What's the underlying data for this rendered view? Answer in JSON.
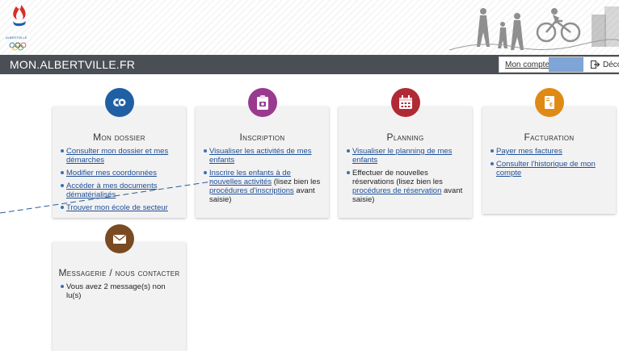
{
  "header": {
    "logo_icon": "albertville-olympic-flame-logo",
    "scene_icon": "family-walking-bicycle-scene"
  },
  "topbar": {
    "site_name": "MON.ALBERTVILLE.FR",
    "account_label": "Mon compte",
    "logout_label": "Déco"
  },
  "cards": {
    "dossier": {
      "icon": "users-icon",
      "color": "#1f5fa3",
      "title": "Mon dossier",
      "items": [
        {
          "link": "Consulter mon dossier et mes démarches"
        },
        {
          "link": "Modifier mes coordonnées"
        },
        {
          "link": "Accéder à mes documents dématérialisés"
        },
        {
          "link": "Trouver mon école de secteur"
        }
      ]
    },
    "inscription": {
      "icon": "clipboard-camera-icon",
      "color": "#9a3a8e",
      "title": "Inscription",
      "items": [
        {
          "link": "Visualiser les activités de mes enfants"
        },
        {
          "link": "Inscrire les enfants à de nouvelles activités",
          "text": " (lisez bien les ",
          "link2": "procédures d'inscriptions",
          "text2": " avant saisie)"
        }
      ]
    },
    "planning": {
      "icon": "calendar-icon",
      "color": "#b02a35",
      "title": "Planning",
      "items": [
        {
          "link": "Visualiser le planning de mes enfants"
        },
        {
          "text": "Effectuer de nouvelles réservations (lisez bien les ",
          "link2": "procédures de réservation",
          "text2": " avant saisie)"
        }
      ]
    },
    "facturation": {
      "icon": "invoice-euro-icon",
      "color": "#e08a16",
      "title": "Facturation",
      "items": [
        {
          "link": "Payer mes factures"
        },
        {
          "link": "Consulter l'historique de mon compte"
        }
      ]
    },
    "messagerie": {
      "icon": "envelope-icon",
      "color": "#7a4a22",
      "title": "Messagerie / nous contacter",
      "items": [
        {
          "text": "Vous avez 2 message(s) non lu(s)"
        }
      ]
    }
  }
}
